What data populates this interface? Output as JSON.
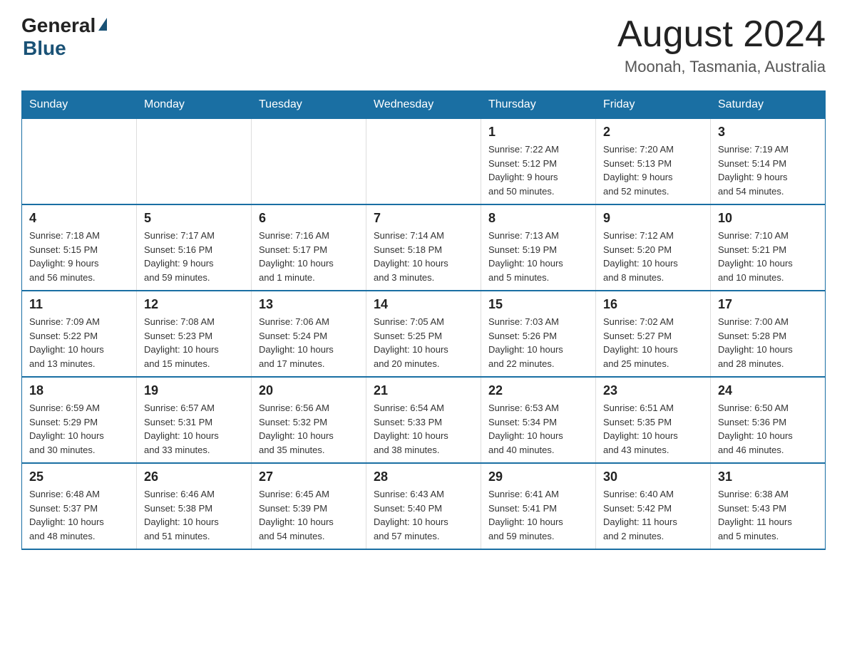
{
  "header": {
    "logo_general": "General",
    "logo_blue": "Blue",
    "month_title": "August 2024",
    "location": "Moonah, Tasmania, Australia"
  },
  "days_of_week": [
    "Sunday",
    "Monday",
    "Tuesday",
    "Wednesday",
    "Thursday",
    "Friday",
    "Saturday"
  ],
  "weeks": [
    [
      {
        "day": "",
        "info": ""
      },
      {
        "day": "",
        "info": ""
      },
      {
        "day": "",
        "info": ""
      },
      {
        "day": "",
        "info": ""
      },
      {
        "day": "1",
        "info": "Sunrise: 7:22 AM\nSunset: 5:12 PM\nDaylight: 9 hours\nand 50 minutes."
      },
      {
        "day": "2",
        "info": "Sunrise: 7:20 AM\nSunset: 5:13 PM\nDaylight: 9 hours\nand 52 minutes."
      },
      {
        "day": "3",
        "info": "Sunrise: 7:19 AM\nSunset: 5:14 PM\nDaylight: 9 hours\nand 54 minutes."
      }
    ],
    [
      {
        "day": "4",
        "info": "Sunrise: 7:18 AM\nSunset: 5:15 PM\nDaylight: 9 hours\nand 56 minutes."
      },
      {
        "day": "5",
        "info": "Sunrise: 7:17 AM\nSunset: 5:16 PM\nDaylight: 9 hours\nand 59 minutes."
      },
      {
        "day": "6",
        "info": "Sunrise: 7:16 AM\nSunset: 5:17 PM\nDaylight: 10 hours\nand 1 minute."
      },
      {
        "day": "7",
        "info": "Sunrise: 7:14 AM\nSunset: 5:18 PM\nDaylight: 10 hours\nand 3 minutes."
      },
      {
        "day": "8",
        "info": "Sunrise: 7:13 AM\nSunset: 5:19 PM\nDaylight: 10 hours\nand 5 minutes."
      },
      {
        "day": "9",
        "info": "Sunrise: 7:12 AM\nSunset: 5:20 PM\nDaylight: 10 hours\nand 8 minutes."
      },
      {
        "day": "10",
        "info": "Sunrise: 7:10 AM\nSunset: 5:21 PM\nDaylight: 10 hours\nand 10 minutes."
      }
    ],
    [
      {
        "day": "11",
        "info": "Sunrise: 7:09 AM\nSunset: 5:22 PM\nDaylight: 10 hours\nand 13 minutes."
      },
      {
        "day": "12",
        "info": "Sunrise: 7:08 AM\nSunset: 5:23 PM\nDaylight: 10 hours\nand 15 minutes."
      },
      {
        "day": "13",
        "info": "Sunrise: 7:06 AM\nSunset: 5:24 PM\nDaylight: 10 hours\nand 17 minutes."
      },
      {
        "day": "14",
        "info": "Sunrise: 7:05 AM\nSunset: 5:25 PM\nDaylight: 10 hours\nand 20 minutes."
      },
      {
        "day": "15",
        "info": "Sunrise: 7:03 AM\nSunset: 5:26 PM\nDaylight: 10 hours\nand 22 minutes."
      },
      {
        "day": "16",
        "info": "Sunrise: 7:02 AM\nSunset: 5:27 PM\nDaylight: 10 hours\nand 25 minutes."
      },
      {
        "day": "17",
        "info": "Sunrise: 7:00 AM\nSunset: 5:28 PM\nDaylight: 10 hours\nand 28 minutes."
      }
    ],
    [
      {
        "day": "18",
        "info": "Sunrise: 6:59 AM\nSunset: 5:29 PM\nDaylight: 10 hours\nand 30 minutes."
      },
      {
        "day": "19",
        "info": "Sunrise: 6:57 AM\nSunset: 5:31 PM\nDaylight: 10 hours\nand 33 minutes."
      },
      {
        "day": "20",
        "info": "Sunrise: 6:56 AM\nSunset: 5:32 PM\nDaylight: 10 hours\nand 35 minutes."
      },
      {
        "day": "21",
        "info": "Sunrise: 6:54 AM\nSunset: 5:33 PM\nDaylight: 10 hours\nand 38 minutes."
      },
      {
        "day": "22",
        "info": "Sunrise: 6:53 AM\nSunset: 5:34 PM\nDaylight: 10 hours\nand 40 minutes."
      },
      {
        "day": "23",
        "info": "Sunrise: 6:51 AM\nSunset: 5:35 PM\nDaylight: 10 hours\nand 43 minutes."
      },
      {
        "day": "24",
        "info": "Sunrise: 6:50 AM\nSunset: 5:36 PM\nDaylight: 10 hours\nand 46 minutes."
      }
    ],
    [
      {
        "day": "25",
        "info": "Sunrise: 6:48 AM\nSunset: 5:37 PM\nDaylight: 10 hours\nand 48 minutes."
      },
      {
        "day": "26",
        "info": "Sunrise: 6:46 AM\nSunset: 5:38 PM\nDaylight: 10 hours\nand 51 minutes."
      },
      {
        "day": "27",
        "info": "Sunrise: 6:45 AM\nSunset: 5:39 PM\nDaylight: 10 hours\nand 54 minutes."
      },
      {
        "day": "28",
        "info": "Sunrise: 6:43 AM\nSunset: 5:40 PM\nDaylight: 10 hours\nand 57 minutes."
      },
      {
        "day": "29",
        "info": "Sunrise: 6:41 AM\nSunset: 5:41 PM\nDaylight: 10 hours\nand 59 minutes."
      },
      {
        "day": "30",
        "info": "Sunrise: 6:40 AM\nSunset: 5:42 PM\nDaylight: 11 hours\nand 2 minutes."
      },
      {
        "day": "31",
        "info": "Sunrise: 6:38 AM\nSunset: 5:43 PM\nDaylight: 11 hours\nand 5 minutes."
      }
    ]
  ]
}
